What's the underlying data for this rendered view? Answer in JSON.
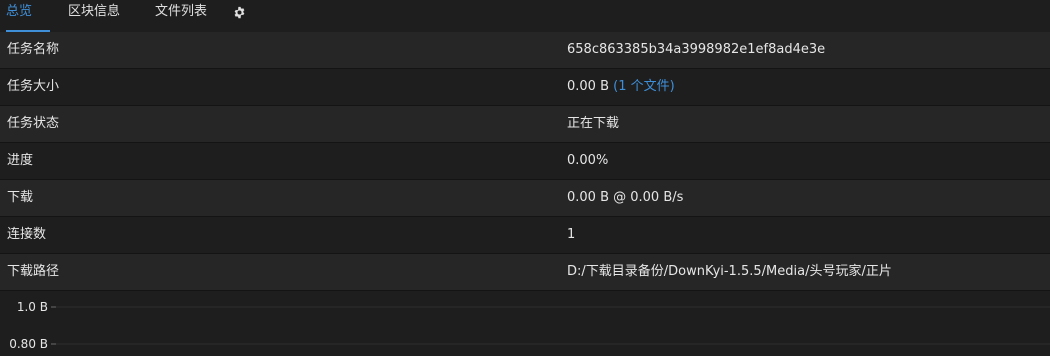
{
  "tabs": {
    "overview": "总览",
    "blocks": "区块信息",
    "files": "文件列表"
  },
  "rows": {
    "name": {
      "label": "任务名称",
      "value": "658c863385b34a3998982e1ef8ad4e3e"
    },
    "size": {
      "label": "任务大小",
      "value": "0.00 B",
      "files_link": "(1 个文件)"
    },
    "status": {
      "label": "任务状态",
      "value": "正在下载"
    },
    "progress": {
      "label": "进度",
      "value": "0.00%"
    },
    "download": {
      "label": "下载",
      "value": "0.00 B @ 0.00 B/s"
    },
    "connections": {
      "label": "连接数",
      "value": "1"
    },
    "path": {
      "label": "下载路径",
      "value": "D:/下载目录备份/DownKyi-1.5.5/Media/头号玩家/正片"
    }
  },
  "chart_data": {
    "type": "line",
    "y_tick_labels": [
      "1.0 B",
      "0.80 B"
    ],
    "y_ticks": [
      1.0,
      0.8
    ],
    "series": []
  },
  "colors": {
    "accent": "#3f8fd8"
  }
}
